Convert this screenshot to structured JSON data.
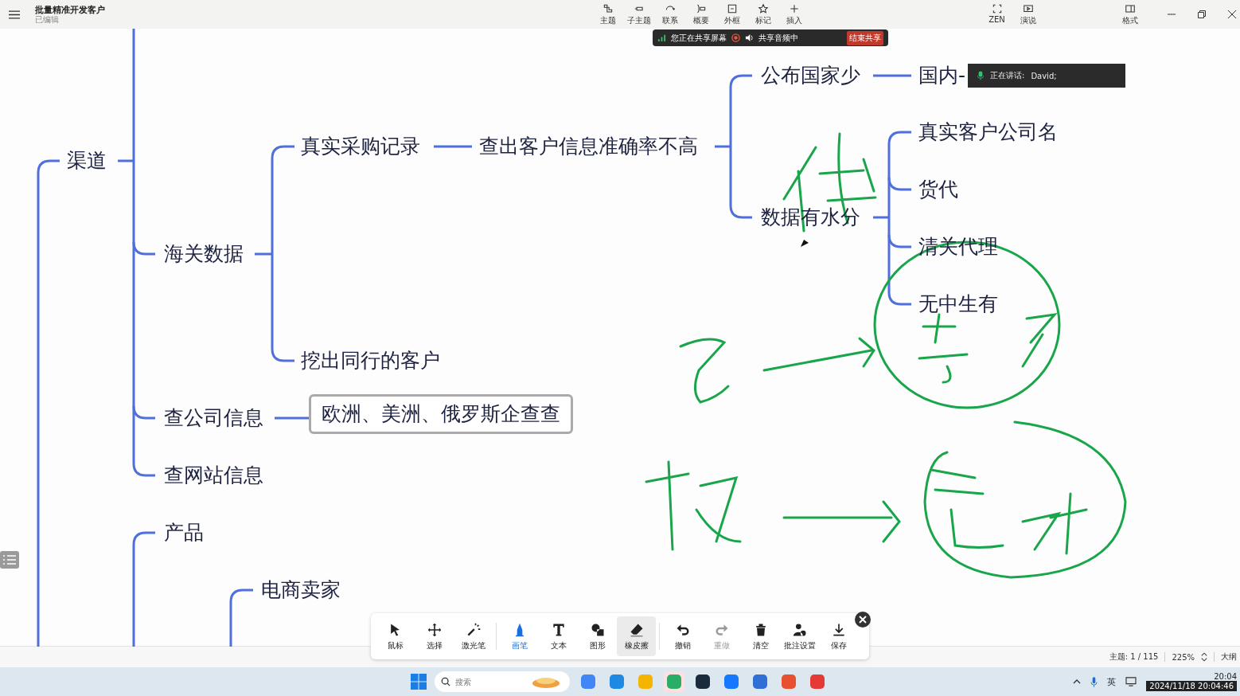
{
  "app": {
    "title": "批量精准开发客户",
    "subtitle": "已编辑"
  },
  "topbar": {
    "tools": [
      "主题",
      "子主题",
      "联系",
      "概要",
      "外框",
      "标记",
      "插入"
    ],
    "view_tools": [
      "ZEN",
      "演说"
    ],
    "format_tool": "格式"
  },
  "share_banner": {
    "status": "您正在共享屏幕",
    "audio": "共享音频中",
    "stop_button": "结束共享"
  },
  "speaking": {
    "label": "正在讲话:",
    "name": "David;"
  },
  "mindmap": {
    "nodes": [
      {
        "text": "渠道",
        "kind": "plain"
      },
      {
        "text": "海关数据",
        "kind": "plain"
      },
      {
        "text": "真实采购记录",
        "kind": "plain"
      },
      {
        "text": "挖出同行的客户",
        "kind": "plain"
      },
      {
        "text": "查出客户信息准确率不高",
        "kind": "plain"
      },
      {
        "text": "公布国家少",
        "kind": "plain"
      },
      {
        "text": "数据有水分",
        "kind": "plain"
      },
      {
        "text": "国内-",
        "kind": "plain"
      },
      {
        "text": "真实客户公司名",
        "kind": "plain"
      },
      {
        "text": "货代",
        "kind": "plain"
      },
      {
        "text": "清关代理",
        "kind": "plain"
      },
      {
        "text": "无中生有",
        "kind": "plain"
      },
      {
        "text": "查公司信息",
        "kind": "plain"
      },
      {
        "text": "欧洲、美洲、俄罗斯企查查",
        "kind": "boxed"
      },
      {
        "text": "查网站信息",
        "kind": "plain"
      },
      {
        "text": "产品",
        "kind": "plain"
      },
      {
        "text": "电商卖家",
        "kind": "plain"
      }
    ]
  },
  "annotation_toolbar": {
    "groups": [
      [
        {
          "label": "鼠标",
          "selected": false,
          "hovered": false,
          "disabled": false
        },
        {
          "label": "选择",
          "selected": false,
          "hovered": false,
          "disabled": false
        },
        {
          "label": "激光笔",
          "selected": false,
          "hovered": false,
          "disabled": false
        }
      ],
      [
        {
          "label": "画笔",
          "selected": true,
          "hovered": false,
          "disabled": false
        },
        {
          "label": "文本",
          "selected": false,
          "hovered": false,
          "disabled": false
        },
        {
          "label": "图形",
          "selected": false,
          "hovered": false,
          "disabled": false
        },
        {
          "label": "橡皮擦",
          "selected": false,
          "hovered": true,
          "disabled": false
        }
      ],
      [
        {
          "label": "撤销",
          "selected": false,
          "hovered": false,
          "disabled": false
        },
        {
          "label": "重做",
          "selected": false,
          "hovered": false,
          "disabled": true
        },
        {
          "label": "清空",
          "selected": false,
          "hovered": false,
          "disabled": false
        },
        {
          "label": "批注设置",
          "selected": false,
          "hovered": false,
          "disabled": false
        },
        {
          "label": "保存",
          "selected": false,
          "hovered": false,
          "disabled": false
        }
      ]
    ]
  },
  "status_bar": {
    "topic_count": "主题: 1 / 115",
    "zoom": "225%",
    "outline": "大纲"
  },
  "taskbar": {
    "search_placeholder": "搜索",
    "apps": [
      {
        "selected": false
      },
      {
        "selected": false
      },
      {
        "selected": false
      },
      {
        "selected": true
      },
      {
        "selected": false
      },
      {
        "selected": false
      },
      {
        "selected": false
      },
      {
        "selected": false
      },
      {
        "selected": false
      }
    ],
    "ime": "英",
    "time": "20:04",
    "datetime": "2024/11/18 20:04:46"
  }
}
